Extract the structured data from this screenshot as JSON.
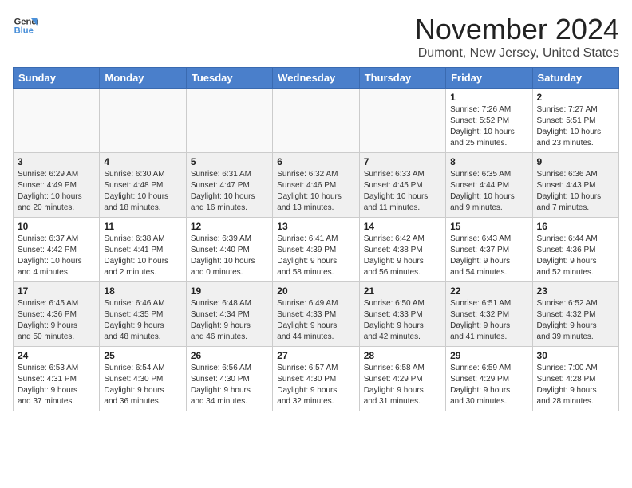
{
  "logo": {
    "line1": "General",
    "line2": "Blue"
  },
  "title": "November 2024",
  "subtitle": "Dumont, New Jersey, United States",
  "weekdays": [
    "Sunday",
    "Monday",
    "Tuesday",
    "Wednesday",
    "Thursday",
    "Friday",
    "Saturday"
  ],
  "weeks": [
    [
      {
        "day": "",
        "info": ""
      },
      {
        "day": "",
        "info": ""
      },
      {
        "day": "",
        "info": ""
      },
      {
        "day": "",
        "info": ""
      },
      {
        "day": "",
        "info": ""
      },
      {
        "day": "1",
        "info": "Sunrise: 7:26 AM\nSunset: 5:52 PM\nDaylight: 10 hours\nand 25 minutes."
      },
      {
        "day": "2",
        "info": "Sunrise: 7:27 AM\nSunset: 5:51 PM\nDaylight: 10 hours\nand 23 minutes."
      }
    ],
    [
      {
        "day": "3",
        "info": "Sunrise: 6:29 AM\nSunset: 4:49 PM\nDaylight: 10 hours\nand 20 minutes."
      },
      {
        "day": "4",
        "info": "Sunrise: 6:30 AM\nSunset: 4:48 PM\nDaylight: 10 hours\nand 18 minutes."
      },
      {
        "day": "5",
        "info": "Sunrise: 6:31 AM\nSunset: 4:47 PM\nDaylight: 10 hours\nand 16 minutes."
      },
      {
        "day": "6",
        "info": "Sunrise: 6:32 AM\nSunset: 4:46 PM\nDaylight: 10 hours\nand 13 minutes."
      },
      {
        "day": "7",
        "info": "Sunrise: 6:33 AM\nSunset: 4:45 PM\nDaylight: 10 hours\nand 11 minutes."
      },
      {
        "day": "8",
        "info": "Sunrise: 6:35 AM\nSunset: 4:44 PM\nDaylight: 10 hours\nand 9 minutes."
      },
      {
        "day": "9",
        "info": "Sunrise: 6:36 AM\nSunset: 4:43 PM\nDaylight: 10 hours\nand 7 minutes."
      }
    ],
    [
      {
        "day": "10",
        "info": "Sunrise: 6:37 AM\nSunset: 4:42 PM\nDaylight: 10 hours\nand 4 minutes."
      },
      {
        "day": "11",
        "info": "Sunrise: 6:38 AM\nSunset: 4:41 PM\nDaylight: 10 hours\nand 2 minutes."
      },
      {
        "day": "12",
        "info": "Sunrise: 6:39 AM\nSunset: 4:40 PM\nDaylight: 10 hours\nand 0 minutes."
      },
      {
        "day": "13",
        "info": "Sunrise: 6:41 AM\nSunset: 4:39 PM\nDaylight: 9 hours\nand 58 minutes."
      },
      {
        "day": "14",
        "info": "Sunrise: 6:42 AM\nSunset: 4:38 PM\nDaylight: 9 hours\nand 56 minutes."
      },
      {
        "day": "15",
        "info": "Sunrise: 6:43 AM\nSunset: 4:37 PM\nDaylight: 9 hours\nand 54 minutes."
      },
      {
        "day": "16",
        "info": "Sunrise: 6:44 AM\nSunset: 4:36 PM\nDaylight: 9 hours\nand 52 minutes."
      }
    ],
    [
      {
        "day": "17",
        "info": "Sunrise: 6:45 AM\nSunset: 4:36 PM\nDaylight: 9 hours\nand 50 minutes."
      },
      {
        "day": "18",
        "info": "Sunrise: 6:46 AM\nSunset: 4:35 PM\nDaylight: 9 hours\nand 48 minutes."
      },
      {
        "day": "19",
        "info": "Sunrise: 6:48 AM\nSunset: 4:34 PM\nDaylight: 9 hours\nand 46 minutes."
      },
      {
        "day": "20",
        "info": "Sunrise: 6:49 AM\nSunset: 4:33 PM\nDaylight: 9 hours\nand 44 minutes."
      },
      {
        "day": "21",
        "info": "Sunrise: 6:50 AM\nSunset: 4:33 PM\nDaylight: 9 hours\nand 42 minutes."
      },
      {
        "day": "22",
        "info": "Sunrise: 6:51 AM\nSunset: 4:32 PM\nDaylight: 9 hours\nand 41 minutes."
      },
      {
        "day": "23",
        "info": "Sunrise: 6:52 AM\nSunset: 4:32 PM\nDaylight: 9 hours\nand 39 minutes."
      }
    ],
    [
      {
        "day": "24",
        "info": "Sunrise: 6:53 AM\nSunset: 4:31 PM\nDaylight: 9 hours\nand 37 minutes."
      },
      {
        "day": "25",
        "info": "Sunrise: 6:54 AM\nSunset: 4:30 PM\nDaylight: 9 hours\nand 36 minutes."
      },
      {
        "day": "26",
        "info": "Sunrise: 6:56 AM\nSunset: 4:30 PM\nDaylight: 9 hours\nand 34 minutes."
      },
      {
        "day": "27",
        "info": "Sunrise: 6:57 AM\nSunset: 4:30 PM\nDaylight: 9 hours\nand 32 minutes."
      },
      {
        "day": "28",
        "info": "Sunrise: 6:58 AM\nSunset: 4:29 PM\nDaylight: 9 hours\nand 31 minutes."
      },
      {
        "day": "29",
        "info": "Sunrise: 6:59 AM\nSunset: 4:29 PM\nDaylight: 9 hours\nand 30 minutes."
      },
      {
        "day": "30",
        "info": "Sunrise: 7:00 AM\nSunset: 4:28 PM\nDaylight: 9 hours\nand 28 minutes."
      }
    ]
  ]
}
